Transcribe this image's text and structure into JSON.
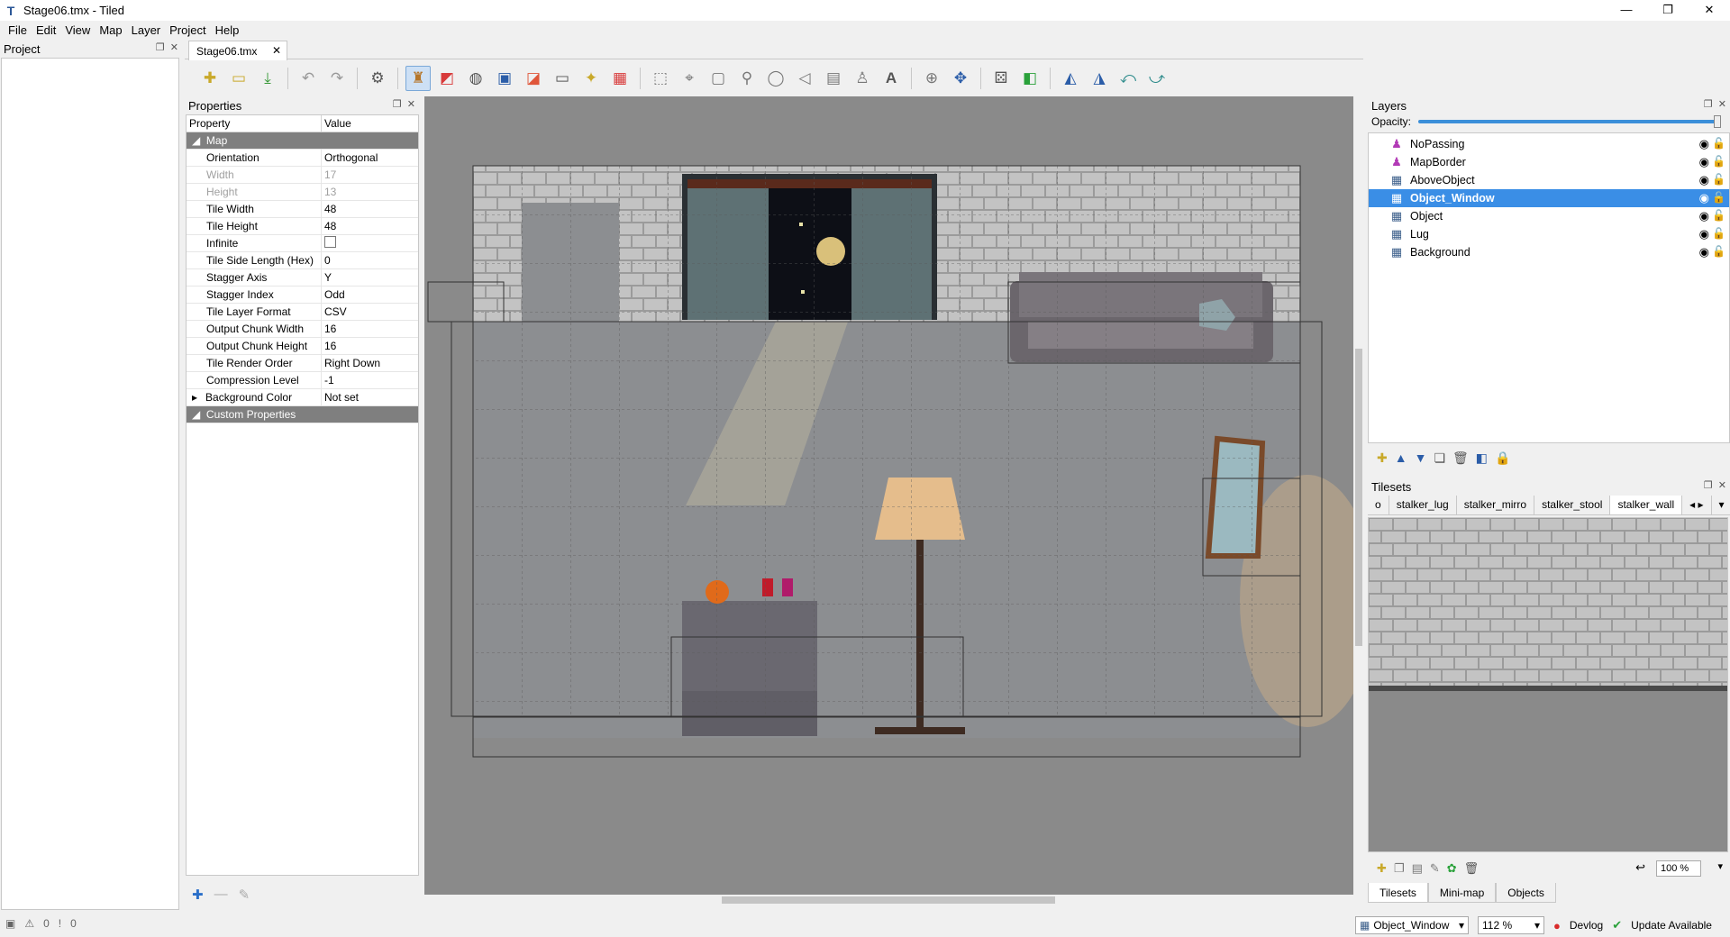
{
  "window": {
    "title": "Stage06.tmx - Tiled",
    "minimize": "—",
    "maximize": "❐",
    "close": "✕"
  },
  "menu": [
    "File",
    "Edit",
    "View",
    "Map",
    "Layer",
    "Project",
    "Help"
  ],
  "project_panel": {
    "title": "Project"
  },
  "document_tab": {
    "label": "Stage06.tmx"
  },
  "properties": {
    "title": "Properties",
    "col_property": "Property",
    "col_value": "Value",
    "group_map": "Map",
    "group_custom": "Custom Properties",
    "rows": [
      {
        "name": "Orientation",
        "value": "Orthogonal",
        "disabled": false
      },
      {
        "name": "Width",
        "value": "17",
        "disabled": true
      },
      {
        "name": "Height",
        "value": "13",
        "disabled": true
      },
      {
        "name": "Tile Width",
        "value": "48",
        "disabled": false
      },
      {
        "name": "Tile Height",
        "value": "48",
        "disabled": false
      },
      {
        "name": "Infinite",
        "value": "",
        "disabled": false,
        "checkbox": true
      },
      {
        "name": "Tile Side Length (Hex)",
        "value": "0",
        "disabled": false
      },
      {
        "name": "Stagger Axis",
        "value": "Y",
        "disabled": false
      },
      {
        "name": "Stagger Index",
        "value": "Odd",
        "disabled": false
      },
      {
        "name": "Tile Layer Format",
        "value": "CSV",
        "disabled": false
      },
      {
        "name": "Output Chunk Width",
        "value": "16",
        "disabled": false
      },
      {
        "name": "Output Chunk Height",
        "value": "16",
        "disabled": false
      },
      {
        "name": "Tile Render Order",
        "value": "Right Down",
        "disabled": false
      },
      {
        "name": "Compression Level",
        "value": "-1",
        "disabled": false
      },
      {
        "name": "Background Color",
        "value": "Not set",
        "disabled": false,
        "expandable": true
      }
    ]
  },
  "layers": {
    "title": "Layers",
    "opacity_label": "Opacity:",
    "opacity_value": 1.0,
    "items": [
      {
        "name": "NoPassing",
        "type": "object"
      },
      {
        "name": "MapBorder",
        "type": "object"
      },
      {
        "name": "AboveObject",
        "type": "tile"
      },
      {
        "name": "Object_Window",
        "type": "tile",
        "selected": true
      },
      {
        "name": "Object",
        "type": "tile"
      },
      {
        "name": "Lug",
        "type": "tile"
      },
      {
        "name": "Background",
        "type": "tile"
      }
    ]
  },
  "tilesets": {
    "title": "Tilesets",
    "tabs": [
      "o",
      "stalker_lug",
      "stalker_mirro",
      "stalker_stool",
      "stalker_wall"
    ],
    "active_tab": "stalker_wall",
    "zoom": "100 %",
    "bottom_tabs": [
      "Tilesets",
      "Mini-map",
      "Objects"
    ]
  },
  "statusbar": {
    "warnings": "0",
    "errors": "0",
    "current_layer": "Object_Window",
    "zoom": "112 %",
    "devlog": "Devlog",
    "update": "Update Available"
  },
  "colors": {
    "selection": "#3a8ee6",
    "canvas_bg": "#8a8a8a",
    "group_row": "#7f7f7f",
    "wall": "#bdbdbd",
    "floor": "#8c8e91"
  }
}
